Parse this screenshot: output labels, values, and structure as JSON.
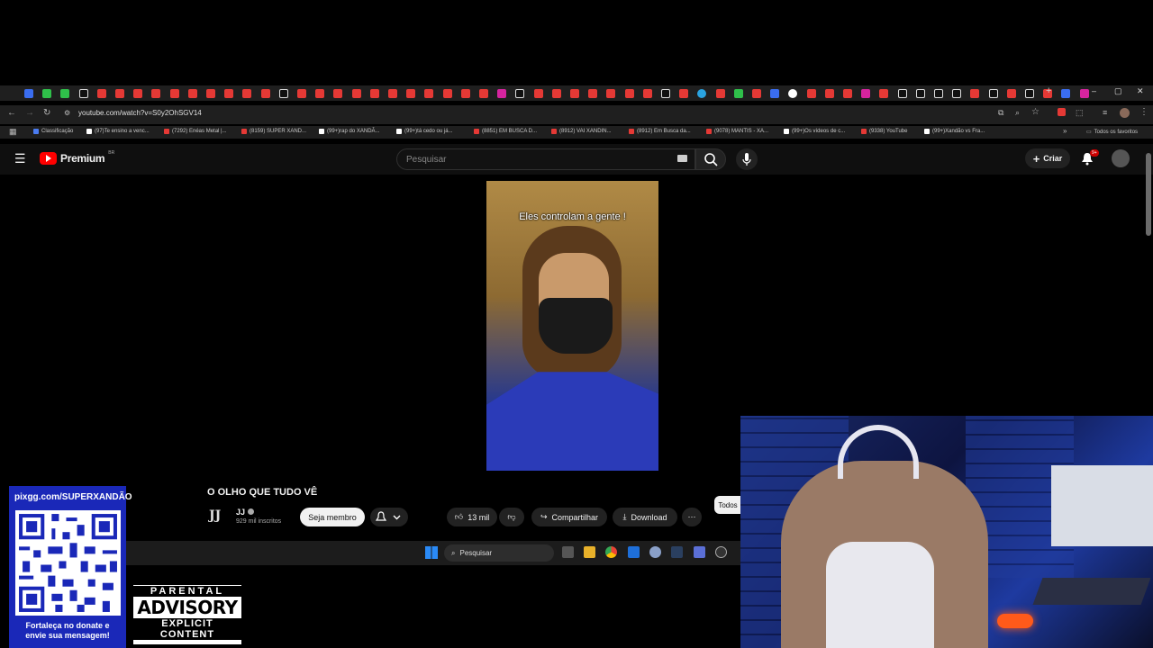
{
  "browser": {
    "url": "youtube.com/watch?v=S0y2OhSGV14",
    "bookmarks": [
      {
        "label": "Classificação",
        "icon": "globe-icon"
      },
      {
        "label": "(97)Te ensino a venc...",
        "icon": "tiktok-icon"
      },
      {
        "label": "(7292) Enéas Metal |...",
        "icon": "youtube-icon"
      },
      {
        "label": "(8159) SUPER XAND...",
        "icon": "youtube-icon"
      },
      {
        "label": "(99+)rap do XANDÃ...",
        "icon": "tiktok-icon"
      },
      {
        "label": "(99+)tá cedo ou já...",
        "icon": "tiktok-icon"
      },
      {
        "label": "(8851) EM BUSCA D...",
        "icon": "youtube-icon"
      },
      {
        "label": "(8912) VAI XANDIN...",
        "icon": "youtube-icon"
      },
      {
        "label": "(8912) Em Busca da...",
        "icon": "youtube-icon"
      },
      {
        "label": "(9078) MANTIS - XA...",
        "icon": "youtube-icon"
      },
      {
        "label": "(99+)Os vídeos de c...",
        "icon": "tiktok-icon"
      },
      {
        "label": "(9338) YouTube",
        "icon": "youtube-icon"
      },
      {
        "label": "(99+)Xandão vs Fra...",
        "icon": "tiktok-icon"
      }
    ],
    "all_favorites": "Todos os favoritos"
  },
  "youtube": {
    "logo_text": "Premium",
    "logo_region": "BR",
    "search_placeholder": "Pesquisar",
    "create_label": "Criar",
    "notification_badge": "9+",
    "video_caption": "Eles controlam a gente !",
    "video_title": "O OLHO QUE TUDO VÊ",
    "channel_logo": "JJ",
    "channel_name": "JJ",
    "subscribers": "929 mil inscritos",
    "member_label": "Seja membro",
    "likes": "13 mil",
    "share_label": "Compartilhar",
    "download_label": "Download",
    "chip_label": "Todos"
  },
  "taskbar": {
    "search_placeholder": "Pesquisar"
  },
  "overlay": {
    "donate_url": "pixgg.com/SUPERXANDÃO",
    "donate_text_1": "Fortaleça no donate e",
    "donate_text_2": "envie sua mensagem!",
    "advisory_1": "PARENTAL",
    "advisory_2": "ADVISORY",
    "advisory_3": "EXPLICIT CONTENT"
  }
}
